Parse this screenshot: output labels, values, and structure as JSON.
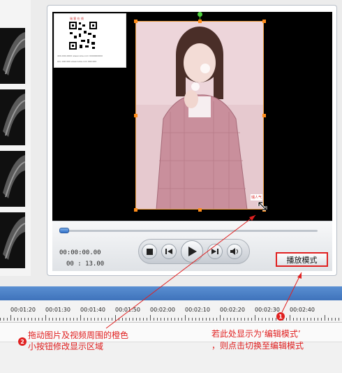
{
  "preview": {
    "current_time": "00:00:00.00",
    "total_time": "00 : 13.00",
    "progress_fraction": 0.0,
    "mode_button_label": "播放模式",
    "qr_card": {
      "brand": "瑞   客  在  线",
      "lines": [
        "400-000-0000  www.ruike.com  0000000000",
        "QQ: 000 000  www.ruike.com  000 000"
      ]
    },
    "video_watermark": "瑞人气"
  },
  "timeline": {
    "ticks": [
      "00:01:20",
      "00:01:30",
      "00:01:40",
      "00:01:50",
      "00:02:00",
      "00:02:10",
      "00:02:20",
      "00:02:30",
      "00:02:40"
    ]
  },
  "annotations": {
    "badge1": "1",
    "badge2": "2",
    "note2_line1": "拖动图片及视频周围的橙色",
    "note2_line2": "小按钮修改显示区域",
    "note1_line1": "若此处显示为‘编辑模式’",
    "note1_line2": "，则点击切换至编辑模式"
  },
  "colors": {
    "accent_red": "#e02020",
    "handle_orange": "#ff8c1a",
    "timeline_blue": "#4a7fc6"
  }
}
